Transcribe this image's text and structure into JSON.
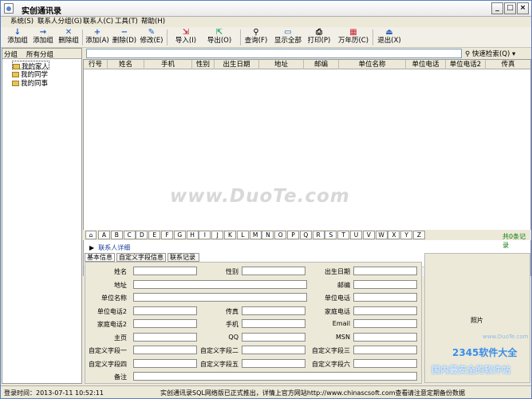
{
  "title": "实创通讯录",
  "menu": [
    "系统(S)",
    "联系人分组(G)",
    "联系人(C)",
    "工具(T)",
    "帮助(H)"
  ],
  "toolbar": [
    {
      "label": "添加组",
      "icon": "arrow-down-icon"
    },
    {
      "label": "添加组",
      "icon": "arrow-right-icon"
    },
    {
      "label": "删除组",
      "icon": "close-icon"
    },
    {
      "label": "添加(A)",
      "icon": "plus-icon"
    },
    {
      "label": "删除(D)",
      "icon": "minus-icon"
    },
    {
      "label": "修改(E)",
      "icon": "pencil-icon"
    },
    {
      "label": "导入(I)",
      "icon": "import-icon"
    },
    {
      "label": "导出(O)",
      "icon": "export-icon"
    },
    {
      "label": "查询(F)",
      "icon": "binoculars-icon"
    },
    {
      "label": "显示全部",
      "icon": "monitor-icon"
    },
    {
      "label": "打印(P)",
      "icon": "printer-icon"
    },
    {
      "label": "万年历(C)",
      "icon": "calendar-icon"
    },
    {
      "label": "退出(X)",
      "icon": "exit-icon"
    }
  ],
  "left": {
    "header1": "分组",
    "header2": "所有分组",
    "groups": [
      "我的家人",
      "我的同学",
      "我的同事"
    ]
  },
  "search": {
    "quick_label": "快速检索(Q)"
  },
  "columns": [
    "行号",
    "姓名",
    "手机",
    "性别",
    "出生日期",
    "地址",
    "邮编",
    "单位名称",
    "单位电话",
    "单位电话2",
    "传真"
  ],
  "alphabet": [
    "A",
    "B",
    "C",
    "D",
    "E",
    "F",
    "G",
    "H",
    "I",
    "J",
    "K",
    "L",
    "M",
    "N",
    "O",
    "P",
    "Q",
    "R",
    "S",
    "T",
    "U",
    "V",
    "W",
    "X",
    "Y",
    "Z"
  ],
  "record_count": "共0条记录",
  "detail": {
    "title": "联系人详细",
    "tabs": [
      "基本信息",
      "自定义字段信息",
      "联系记录"
    ],
    "photo_label": "照片",
    "fields": [
      [
        "姓名",
        "性别",
        "出生日期"
      ],
      [
        "地址",
        "",
        "邮编"
      ],
      [
        "单位名称",
        "",
        "单位电话"
      ],
      [
        "单位电话2",
        "传真",
        "家庭电话"
      ],
      [
        "家庭电话2",
        "手机",
        "Email"
      ],
      [
        "主页",
        "QQ",
        "MSN"
      ],
      [
        "自定义字段一",
        "自定义字段二",
        "自定义字段三"
      ],
      [
        "自定义字段四",
        "自定义字段五",
        "自定义字段六"
      ],
      [
        "备注",
        "",
        ""
      ]
    ]
  },
  "status": {
    "login": "登录时间：2013-07-11 10:52:11",
    "info": "实创通讯录SQL网络版已正式推出，详情上官方网站http://www.chinascsoft.com查看",
    "backup": "请注意定期备份数据"
  },
  "watermark": "www.DuoTe.com",
  "brand": {
    "big": "2345软件大全",
    "small": "国内最安全的软件站",
    "site": "www.DuoTe.com"
  }
}
